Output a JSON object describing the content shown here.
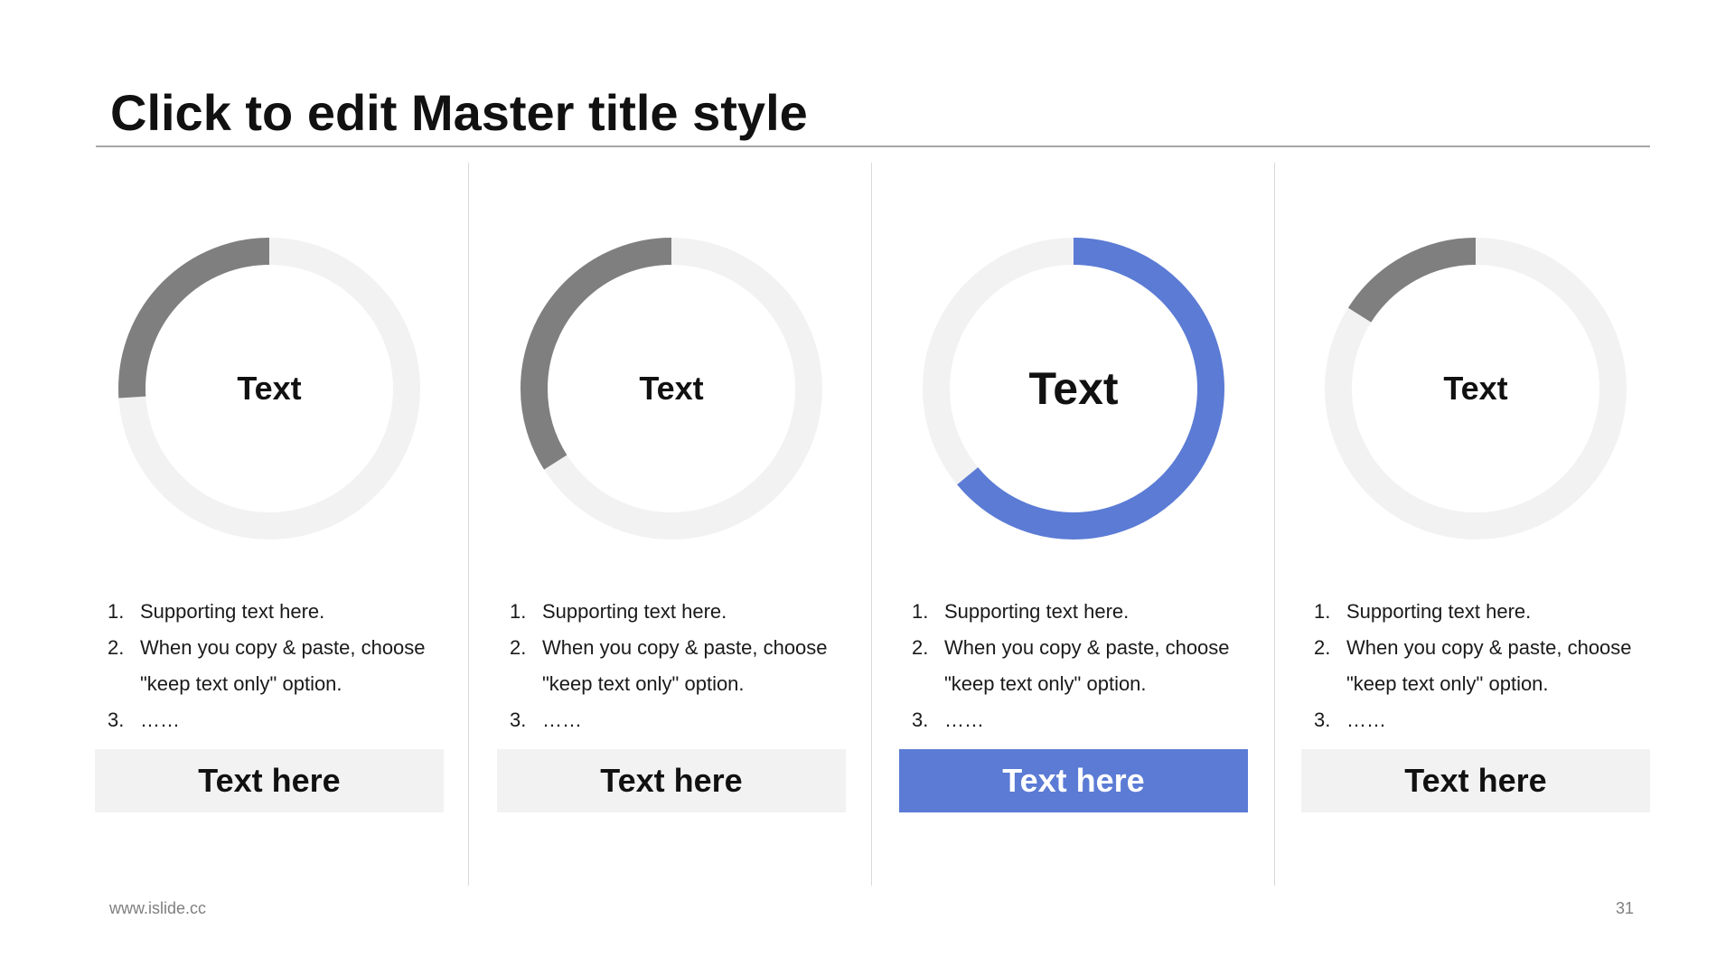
{
  "slide": {
    "title": "Click to edit Master title style",
    "footer_url": "www.islide.cc",
    "page_number": "31"
  },
  "colors": {
    "track": "#f2f2f2",
    "progress_gray": "#7f7f7f",
    "accent": "#5b7bd5"
  },
  "cards": [
    {
      "ring_label": "Text",
      "progress_fraction": 0.26,
      "highlighted": false,
      "list": [
        {
          "num": "1.",
          "text": "Supporting text here."
        },
        {
          "num": "2.",
          "text": "When you copy & paste, choose \"keep text only\" option."
        },
        {
          "num": "3.",
          "text": "……"
        }
      ],
      "button_label": "Text here"
    },
    {
      "ring_label": "Text",
      "progress_fraction": 0.34,
      "highlighted": false,
      "list": [
        {
          "num": "1.",
          "text": "Supporting text here."
        },
        {
          "num": "2.",
          "text": "When you copy & paste, choose \"keep text only\" option."
        },
        {
          "num": "3.",
          "text": "……"
        }
      ],
      "button_label": "Text here"
    },
    {
      "ring_label": "Text",
      "progress_fraction": 0.64,
      "highlighted": true,
      "list": [
        {
          "num": "1.",
          "text": "Supporting text here."
        },
        {
          "num": "2.",
          "text": "When you copy & paste, choose \"keep text only\" option."
        },
        {
          "num": "3.",
          "text": "……"
        }
      ],
      "button_label": "Text here"
    },
    {
      "ring_label": "Text",
      "progress_fraction": 0.16,
      "highlighted": false,
      "list": [
        {
          "num": "1.",
          "text": "Supporting text here."
        },
        {
          "num": "2.",
          "text": "When you copy & paste, choose \"keep text only\" option."
        },
        {
          "num": "3.",
          "text": "……"
        }
      ],
      "button_label": "Text here"
    }
  ]
}
